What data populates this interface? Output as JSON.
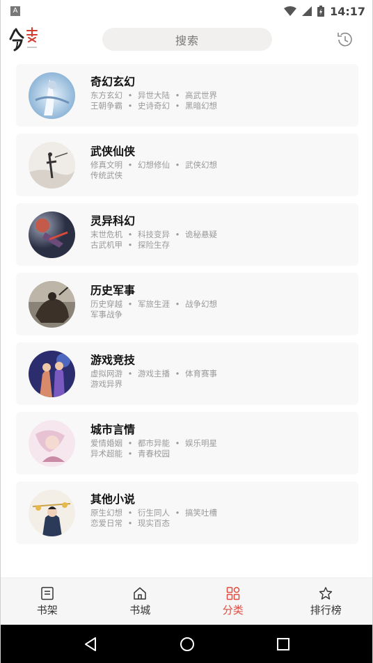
{
  "status_bar": {
    "notification_icon": "A",
    "time": "14:17",
    "icons": [
      "wifi-icon",
      "signal-icon",
      "battery-icon"
    ]
  },
  "header": {
    "logo_icon": "fenlei-logo-icon",
    "search_placeholder": "搜索",
    "history_icon": "history-icon"
  },
  "categories": [
    {
      "title": "奇幻玄幻",
      "tag_rows": [
        [
          "东方玄幻",
          "异世大陆",
          "高武世界"
        ],
        [
          "王朝争霸",
          "史诗奇幻",
          "黑暗幻想"
        ]
      ]
    },
    {
      "title": "武侠仙侠",
      "tag_rows": [
        [
          "修真文明",
          "幻想修仙",
          "武侠幻想"
        ],
        [
          "传统武侠"
        ]
      ]
    },
    {
      "title": "灵异科幻",
      "tag_rows": [
        [
          "末世危机",
          "科技变异",
          "诡秘悬疑"
        ],
        [
          "古武机甲",
          "探险生存"
        ]
      ]
    },
    {
      "title": "历史军事",
      "tag_rows": [
        [
          "历史穿越",
          "军旅生涯",
          "战争幻想"
        ],
        [
          "军事战争"
        ]
      ]
    },
    {
      "title": "游戏竞技",
      "tag_rows": [
        [
          "虚拟网游",
          "游戏主播",
          "体育赛事"
        ],
        [
          "游戏异界"
        ]
      ]
    },
    {
      "title": "城市言情",
      "tag_rows": [
        [
          "爱情婚姻",
          "都市异能",
          "娱乐明星"
        ],
        [
          "异术超能",
          "青春校园"
        ]
      ]
    },
    {
      "title": "其他小说",
      "tag_rows": [
        [
          "原生幻想",
          "衍生同人",
          "搞笑吐槽"
        ],
        [
          "恋爱日常",
          "现实百态"
        ]
      ]
    }
  ],
  "separator": "•",
  "bottom_nav": [
    {
      "label": "书架",
      "icon": "bookshelf-icon",
      "active": false
    },
    {
      "label": "书城",
      "icon": "home-icon",
      "active": false
    },
    {
      "label": "分类",
      "icon": "category-grid-icon",
      "active": true
    },
    {
      "label": "排行榜",
      "icon": "star-ranking-icon",
      "active": false
    }
  ],
  "colors": {
    "accent": "#e04a3c",
    "card_bg": "#f8f8f8",
    "search_bg": "#f2f0ef"
  }
}
